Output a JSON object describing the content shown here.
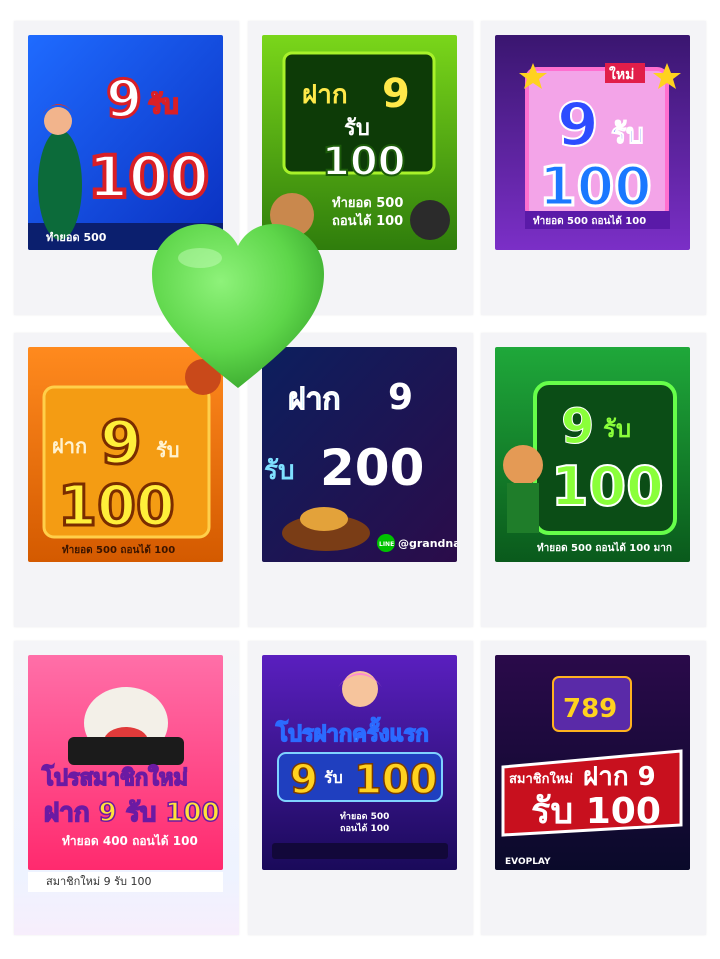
{
  "colors": {
    "heart": "#5ed64a",
    "page_bg": "#ffffff",
    "card_bg": "#f4f4f7"
  },
  "posters": [
    {
      "lines": [
        "9",
        "รับ",
        "100"
      ],
      "footer": "ทำยอด 500"
    },
    {
      "lines": [
        "ฝาก",
        "9",
        "รับ",
        "100"
      ],
      "footer_lines": [
        "ทำยอด 500",
        "ถอนได้ 100"
      ]
    },
    {
      "badge": "ใหม่",
      "lines": [
        "9",
        "รับ",
        "100"
      ],
      "footer": "ทำยอด 500 ถอนได้ 100"
    },
    {
      "lines": [
        "ฝาก",
        "9",
        "รับ",
        "100"
      ],
      "footer": "ทำยอด 500 ถอนได้ 100"
    },
    {
      "lines": [
        "ฝาก",
        "9",
        "รับ",
        "200"
      ],
      "footer": "@grandnas",
      "line_badge": "LINE"
    },
    {
      "lines": [
        "9",
        "รับ",
        "100"
      ],
      "footer": "ทำยอด 500 ถอนได้ 100 มาก"
    },
    {
      "lines": [
        "โปรสมาชิกใหม่",
        "ฝาก 9 รับ 100"
      ],
      "footer": "ทำยอด 400 ถอนได้ 100",
      "caption": "สมาชิกใหม่ 9 รับ 100"
    },
    {
      "lines": [
        "โปรฝากครั้งแรก",
        "9",
        "รับ",
        "100"
      ],
      "footer_lines": [
        "ทำยอด 500",
        "ถอนได้ 100"
      ]
    },
    {
      "lines": [
        "สมาชิกใหม่",
        "ฝาก 9",
        "รับ 100"
      ],
      "footer": "EVOPLAY",
      "reels": "789"
    }
  ]
}
